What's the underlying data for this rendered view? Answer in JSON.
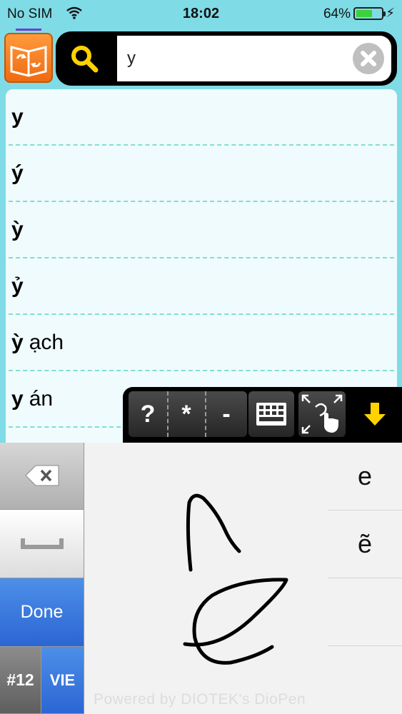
{
  "status": {
    "carrier": "No SIM",
    "time": "18:02",
    "battery_percent_label": "64%",
    "battery_level": 0.64
  },
  "search": {
    "value": "y"
  },
  "results": [
    {
      "word": "y",
      "rest": ""
    },
    {
      "word": "ý",
      "rest": ""
    },
    {
      "word": "ỳ",
      "rest": ""
    },
    {
      "word": "ỷ",
      "rest": ""
    },
    {
      "word": "ỳ",
      "rest": "ạch"
    },
    {
      "word": "y",
      "rest": "án"
    }
  ],
  "toolbar": {
    "question_label": "?",
    "star_label": "*",
    "dash_label": "-"
  },
  "keyboard": {
    "done_label": "Done",
    "numbers_label": "#12",
    "language_label": "VIE",
    "candidates": [
      "e",
      "ẽ",
      "",
      ""
    ],
    "powered_by": "Powered by DIOTEK's DioPen"
  },
  "colors": {
    "background": "#7fdbe6",
    "accent_orange": "#f06a10",
    "search_icon": "#ffd200",
    "done_blue": "#2b66d3",
    "arrow_yellow": "#ffd200"
  }
}
